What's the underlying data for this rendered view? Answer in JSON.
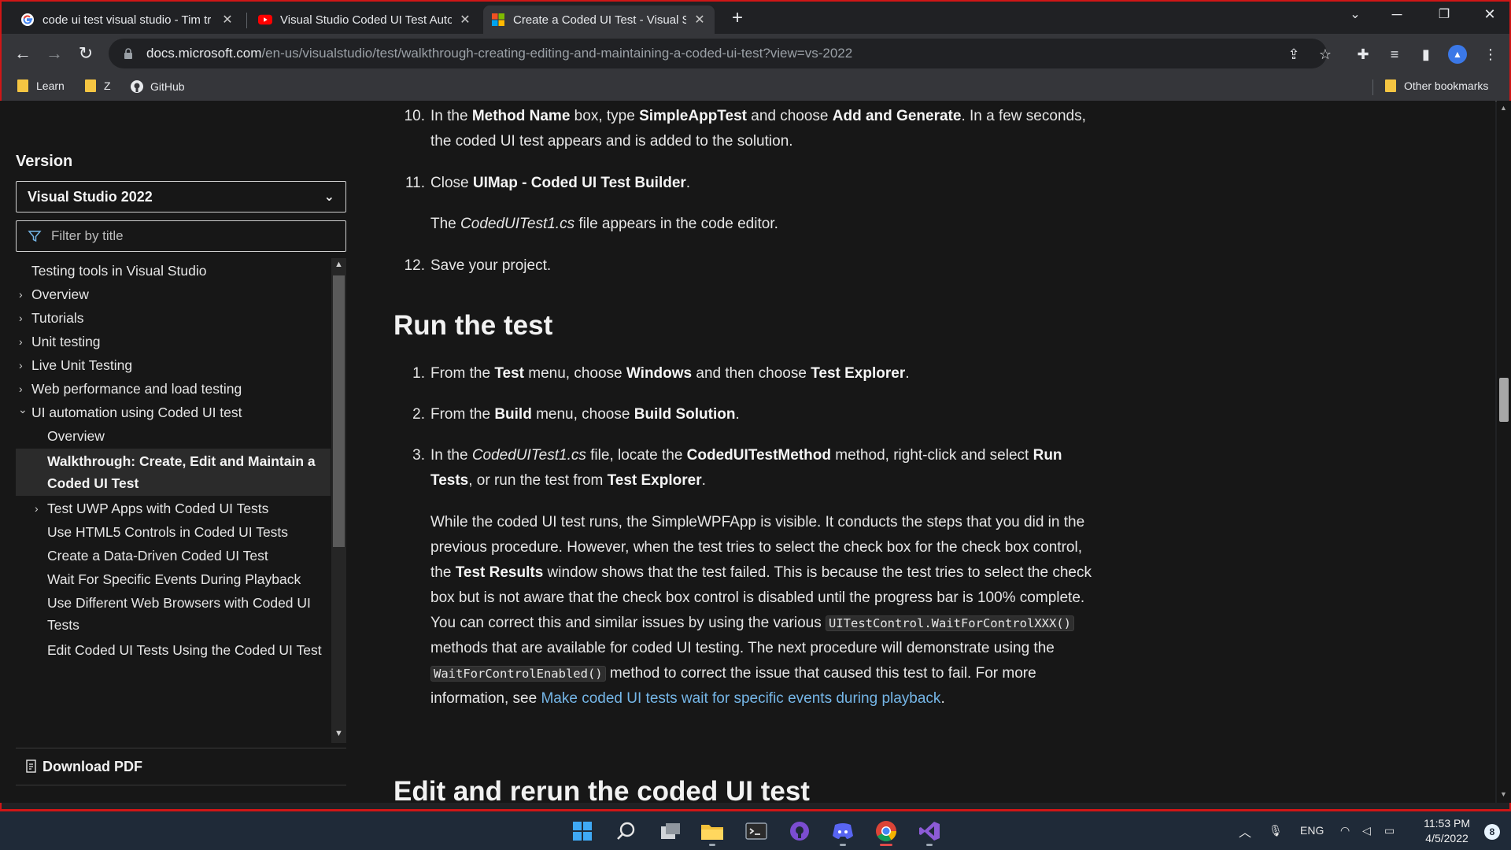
{
  "tabs": [
    {
      "title": "code ui test visual studio - Tim tr",
      "icon": "google-icon"
    },
    {
      "title": "Visual Studio Coded UI Test Auto",
      "icon": "youtube-icon"
    },
    {
      "title": "Create a Coded UI Test - Visual S",
      "icon": "microsoft-icon",
      "active": true
    }
  ],
  "address": {
    "host": "docs.microsoft.com",
    "path": "/en-us/visualstudio/test/walkthrough-creating-editing-and-maintaining-a-coded-ui-test?view=vs-2022"
  },
  "bookmarks": {
    "items": [
      {
        "label": "Learn"
      },
      {
        "label": "Z"
      },
      {
        "label": "GitHub"
      }
    ],
    "other": "Other bookmarks"
  },
  "sidebar": {
    "version_label": "Version",
    "version_selected": "Visual Studio 2022",
    "filter_placeholder": "Filter by title",
    "toc": [
      {
        "label": "Testing tools in Visual Studio",
        "level": 0,
        "chevron": ""
      },
      {
        "label": "Overview",
        "level": 0,
        "chevron": "›"
      },
      {
        "label": "Tutorials",
        "level": 0,
        "chevron": "›"
      },
      {
        "label": "Unit testing",
        "level": 0,
        "chevron": "›"
      },
      {
        "label": "Live Unit Testing",
        "level": 0,
        "chevron": "›"
      },
      {
        "label": "Web performance and load testing",
        "level": 0,
        "chevron": "›"
      },
      {
        "label": "UI automation using Coded UI test",
        "level": 0,
        "chevron": "⌄"
      },
      {
        "label": "Overview",
        "level": 1,
        "chevron": ""
      },
      {
        "label": "Walkthrough: Create, Edit and Maintain a",
        "label2": "Coded UI Test",
        "level": 1,
        "chevron": "",
        "active": true
      },
      {
        "label": "Test UWP Apps with Coded UI Tests",
        "level": 1,
        "chevron": "›"
      },
      {
        "label": "Use HTML5 Controls in Coded UI Tests",
        "level": 1,
        "chevron": ""
      },
      {
        "label": "Create a Data-Driven Coded UI Test",
        "level": 1,
        "chevron": ""
      },
      {
        "label": "Wait For Specific Events During Playback",
        "level": 1,
        "chevron": ""
      },
      {
        "label": "Use Different Web Browsers with Coded UI",
        "label2": "Tests",
        "level": 1,
        "chevron": ""
      },
      {
        "label": "Edit Coded UI Tests Using the Coded UI Test",
        "level": 1,
        "chevron": ""
      }
    ],
    "download_label": "Download PDF"
  },
  "content": {
    "step10_num": "10.",
    "step10_a": "In the ",
    "step10_b": "Method Name",
    "step10_c": " box, type ",
    "step10_d": "SimpleAppTest",
    "step10_e": " and choose ",
    "step10_f": "Add and Generate",
    "step10_g": ". In a few seconds, the coded UI test appears and is added to the solution.",
    "step11_num": "11.",
    "step11_a": "Close ",
    "step11_b": "UIMap - Coded UI Test Builder",
    "step11_c": ".",
    "step11_note_a": "The ",
    "step11_note_b": "CodedUITest1.cs",
    "step11_note_c": " file appears in the code editor.",
    "step12_num": "12.",
    "step12": "Save your project.",
    "h_run": "Run the test",
    "r1_num": "1.",
    "r1_a": "From the ",
    "r1_b": "Test",
    "r1_c": " menu, choose ",
    "r1_d": "Windows",
    "r1_e": " and then choose ",
    "r1_f": "Test Explorer",
    "r1_g": ".",
    "r2_num": "2.",
    "r2_a": "From the ",
    "r2_b": "Build",
    "r2_c": " menu, choose ",
    "r2_d": "Build Solution",
    "r2_e": ".",
    "r3_num": "3.",
    "r3_a": "In the ",
    "r3_b": "CodedUITest1.cs",
    "r3_c": " file, locate the ",
    "r3_d": "CodedUITestMethod",
    "r3_e": " method, right-click and select ",
    "r3_f": "Run Tests",
    "r3_g": ", or run the test from ",
    "r3_h": "Test Explorer",
    "r3_i": ".",
    "p_a": "While the coded UI test runs, the SimpleWPFApp is visible. It conducts the steps that you did in the previous procedure. However, when the test tries to select the check box for the check box control, the ",
    "p_b": "Test Results",
    "p_c": " window shows that the test failed. This is because the test tries to select the check box but is not aware that the check box control is disabled until the progress bar is 100% complete. You can correct this and similar issues by using the various ",
    "p_code1": "UITestControl.WaitForControlXXX()",
    "p_d": " methods that are available for coded UI testing. The next procedure will demonstrate using the ",
    "p_code2": "WaitForControlEnabled()",
    "p_e": " method to correct the issue that caused this test to fail. For more information, see ",
    "p_link": "Make coded UI tests wait for specific events during playback",
    "p_f": ".",
    "h_edit": "Edit and rerun the coded UI test"
  },
  "taskbar": {
    "lang": "ENG",
    "time": "11:53 PM",
    "date": "4/5/2022",
    "notifications": "8"
  }
}
